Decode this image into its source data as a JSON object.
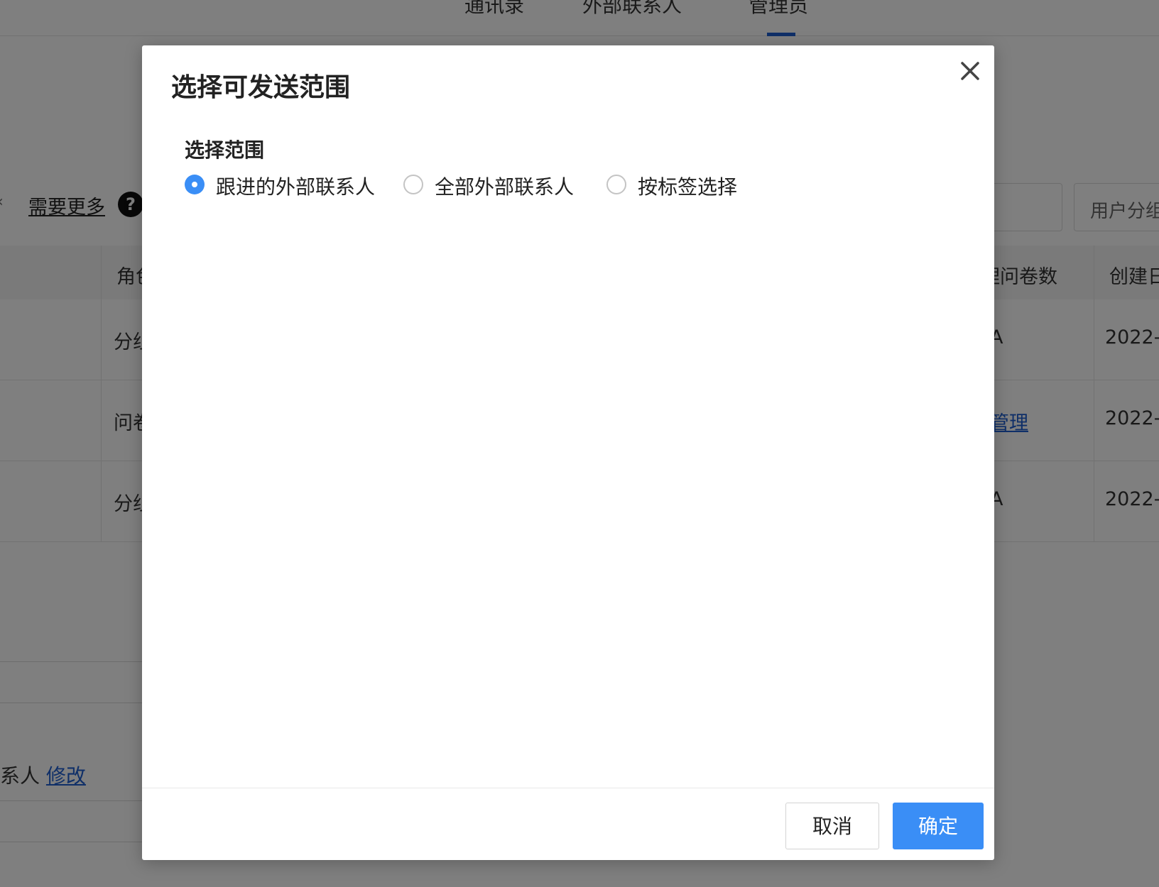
{
  "background": {
    "top_tabs": [
      {
        "label": "通讯录"
      },
      {
        "label": "外部联系人"
      },
      {
        "label": "管理员"
      }
    ],
    "need_more_label": "需要更多",
    "help_glyph": "?",
    "select_placeholder": "用户分组",
    "table": {
      "headers": [
        "角色",
        "管理问卷数",
        "创建日期"
      ],
      "rows": [
        {
          "role": "分组",
          "count": "A",
          "date": "2022-"
        },
        {
          "role": "问卷",
          "count": "管理",
          "date": "2022-"
        },
        {
          "role": "分组",
          "count": "A",
          "date": "2022-"
        }
      ]
    },
    "contact_text": "系人",
    "modify_link": "修改"
  },
  "modal": {
    "title": "选择可发送范围",
    "close_icon": "close-icon",
    "section_label": "选择范围",
    "options": [
      {
        "label": "跟进的外部联系人",
        "checked": true
      },
      {
        "label": "全部外部联系人",
        "checked": false
      },
      {
        "label": "按标签选择",
        "checked": false
      }
    ],
    "cancel_label": "取消",
    "confirm_label": "确定"
  },
  "colors": {
    "primary": "#3a8ef6",
    "overlay": "rgba(0,0,0,0.5)",
    "link": "#1f5fd1"
  }
}
